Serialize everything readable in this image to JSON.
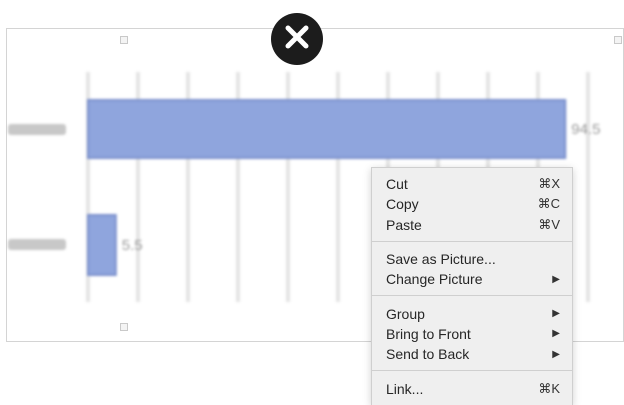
{
  "chart_data": {
    "type": "bar",
    "orientation": "horizontal",
    "categories": [
      "",
      ""
    ],
    "values": [
      94.5,
      5.5
    ],
    "value_labels": [
      "94.5",
      "5.5"
    ],
    "xlim": [
      0,
      100
    ],
    "bar_color": "#8fa5dd",
    "grid": true
  },
  "context_menu": {
    "groups": [
      [
        {
          "label": "Cut",
          "shortcut": "⌘X"
        },
        {
          "label": "Copy",
          "shortcut": "⌘C"
        },
        {
          "label": "Paste",
          "shortcut": "⌘V"
        }
      ],
      [
        {
          "label": "Save as Picture...",
          "shortcut": ""
        },
        {
          "label": "Change Picture",
          "shortcut": "▶"
        }
      ],
      [
        {
          "label": "Group",
          "shortcut": "▶"
        },
        {
          "label": "Bring to Front",
          "shortcut": "▶"
        },
        {
          "label": "Send to Back",
          "shortcut": "▶"
        }
      ],
      [
        {
          "label": "Link...",
          "shortcut": "⌘K"
        }
      ]
    ]
  },
  "delete_badge": {
    "icon": "close-icon"
  }
}
